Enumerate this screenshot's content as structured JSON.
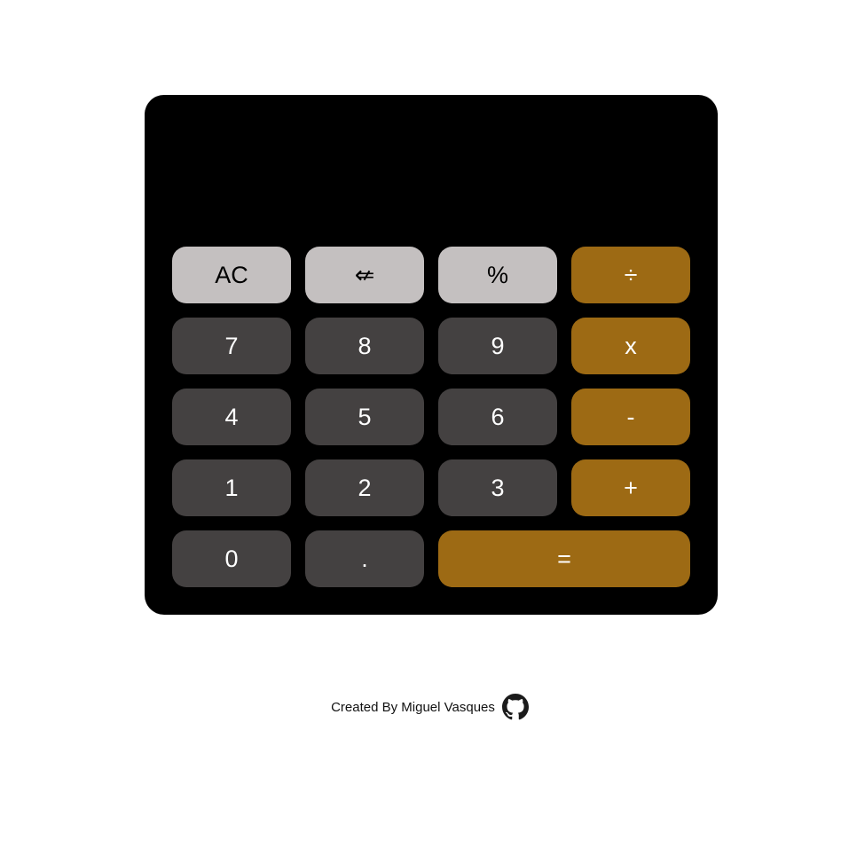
{
  "display": {
    "value": ""
  },
  "keys": {
    "clear": "AC",
    "backspace": "⇍",
    "percent": "%",
    "divide": "÷",
    "seven": "7",
    "eight": "8",
    "nine": "9",
    "multiply": "x",
    "four": "4",
    "five": "5",
    "six": "6",
    "subtract": "-",
    "one": "1",
    "two": "2",
    "three": "3",
    "add": "+",
    "zero": "0",
    "decimal": ".",
    "equals": "="
  },
  "footer": {
    "text": "Created By Miguel Vasques",
    "icon": "github-icon"
  },
  "colors": {
    "calculator_bg": "#000000",
    "function_key": "#c4c0c0",
    "number_key": "#444141",
    "operator_key": "#9d6a14"
  }
}
